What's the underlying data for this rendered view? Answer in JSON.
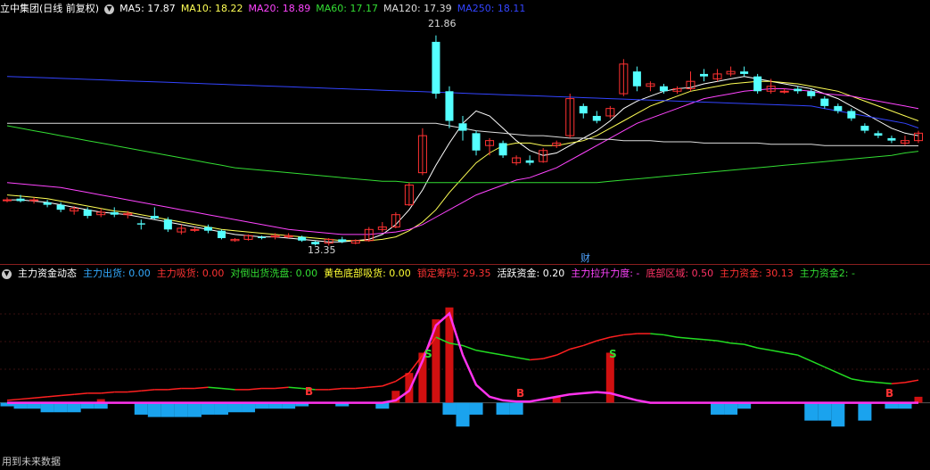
{
  "main_header": {
    "stock": "立中集团(日线 前复权)",
    "ma": [
      {
        "label": "MA5: 17.87",
        "color": "#ffffff"
      },
      {
        "label": "MA10: 18.22",
        "color": "#ffff55"
      },
      {
        "label": "MA20: 18.89",
        "color": "#ff44ff"
      },
      {
        "label": "MA60: 17.17",
        "color": "#33dd33"
      },
      {
        "label": "MA120: 17.39",
        "color": "#dddddd"
      },
      {
        "label": "MA250: 18.11",
        "color": "#3344ff"
      }
    ]
  },
  "price_labels": {
    "high": "21.86",
    "low": "13.35",
    "fin_marker": "财"
  },
  "indicator_header": {
    "name": "主力资金动态",
    "items": [
      {
        "label": "主力出货: 0.00",
        "color": "#33aaff"
      },
      {
        "label": "主力吸货: 0.00",
        "color": "#ff3333"
      },
      {
        "label": "对倒出货洗盘: 0.00",
        "color": "#33dd33"
      },
      {
        "label": "黄色底部吸货: 0.00",
        "color": "#ffff33"
      },
      {
        "label": "锁定筹码: 29.35",
        "color": "#ff3333"
      },
      {
        "label": "活跃资金: 0.20",
        "color": "#ffffff"
      },
      {
        "label": "主力拉升力度: -",
        "color": "#ff44ff"
      },
      {
        "label": "底部区域: 0.50",
        "color": "#ff3366"
      },
      {
        "label": "主力资金: 30.13",
        "color": "#ff3333"
      },
      {
        "label": "主力资金2: -",
        "color": "#33dd33"
      }
    ]
  },
  "markers": [
    "B",
    "S",
    "B",
    "S",
    "B"
  ],
  "footer": "用到未来数据",
  "chart_data": {
    "type": "candlestick",
    "ylim": [
      13.0,
      22.5
    ],
    "candles": [
      {
        "o": 15.2,
        "c": 15.2,
        "h": 15.3,
        "l": 15.1
      },
      {
        "o": 15.25,
        "c": 15.15,
        "h": 15.4,
        "l": 15.1
      },
      {
        "o": 15.2,
        "c": 15.2,
        "h": 15.3,
        "l": 15.05
      },
      {
        "o": 15.1,
        "c": 15.0,
        "h": 15.2,
        "l": 14.9
      },
      {
        "o": 15.0,
        "c": 14.8,
        "h": 15.1,
        "l": 14.7
      },
      {
        "o": 14.75,
        "c": 14.85,
        "h": 14.95,
        "l": 14.6
      },
      {
        "o": 14.8,
        "c": 14.55,
        "h": 14.9,
        "l": 14.45
      },
      {
        "o": 14.6,
        "c": 14.7,
        "h": 14.85,
        "l": 14.5
      },
      {
        "o": 14.7,
        "c": 14.6,
        "h": 14.9,
        "l": 14.5
      },
      {
        "o": 14.6,
        "c": 14.65,
        "h": 14.75,
        "l": 14.45
      },
      {
        "o": 14.25,
        "c": 14.2,
        "h": 14.4,
        "l": 14.0
      },
      {
        "o": 14.55,
        "c": 14.45,
        "h": 14.9,
        "l": 14.4
      },
      {
        "o": 14.4,
        "c": 14.0,
        "h": 14.5,
        "l": 13.9
      },
      {
        "o": 13.9,
        "c": 14.05,
        "h": 14.2,
        "l": 13.8
      },
      {
        "o": 14.0,
        "c": 14.0,
        "h": 14.1,
        "l": 13.9
      },
      {
        "o": 14.1,
        "c": 13.95,
        "h": 14.2,
        "l": 13.85
      },
      {
        "o": 13.95,
        "c": 13.65,
        "h": 14.0,
        "l": 13.6
      },
      {
        "o": 13.55,
        "c": 13.6,
        "h": 13.65,
        "l": 13.5
      },
      {
        "o": 13.6,
        "c": 13.75,
        "h": 13.8,
        "l": 13.55
      },
      {
        "o": 13.7,
        "c": 13.65,
        "h": 13.75,
        "l": 13.6
      },
      {
        "o": 13.7,
        "c": 13.75,
        "h": 13.85,
        "l": 13.6
      },
      {
        "o": 13.7,
        "c": 13.75,
        "h": 13.85,
        "l": 13.65
      },
      {
        "o": 13.7,
        "c": 13.55,
        "h": 13.75,
        "l": 13.5
      },
      {
        "o": 13.5,
        "c": 13.4,
        "h": 13.55,
        "l": 13.35
      },
      {
        "o": 13.45,
        "c": 13.6,
        "h": 13.65,
        "l": 13.35
      },
      {
        "o": 13.6,
        "c": 13.5,
        "h": 13.7,
        "l": 13.45
      },
      {
        "o": 13.45,
        "c": 13.55,
        "h": 13.6,
        "l": 13.4
      },
      {
        "o": 13.55,
        "c": 14.0,
        "h": 14.1,
        "l": 13.5
      },
      {
        "o": 14.0,
        "c": 14.1,
        "h": 14.3,
        "l": 13.9
      },
      {
        "o": 14.1,
        "c": 14.6,
        "h": 14.7,
        "l": 14.05
      },
      {
        "o": 15.0,
        "c": 15.8,
        "h": 15.9,
        "l": 14.95
      },
      {
        "o": 16.3,
        "c": 17.8,
        "h": 18.1,
        "l": 16.2
      },
      {
        "o": 21.6,
        "c": 19.5,
        "h": 21.86,
        "l": 19.3
      },
      {
        "o": 19.6,
        "c": 18.4,
        "h": 19.8,
        "l": 18.1
      },
      {
        "o": 18.3,
        "c": 18.0,
        "h": 18.6,
        "l": 17.6
      },
      {
        "o": 17.9,
        "c": 17.2,
        "h": 18.0,
        "l": 17.0
      },
      {
        "o": 17.4,
        "c": 17.6,
        "h": 17.7,
        "l": 17.0
      },
      {
        "o": 17.5,
        "c": 17.0,
        "h": 17.6,
        "l": 16.9
      },
      {
        "o": 16.7,
        "c": 16.9,
        "h": 17.0,
        "l": 16.6
      },
      {
        "o": 16.8,
        "c": 16.7,
        "h": 17.0,
        "l": 16.6
      },
      {
        "o": 16.75,
        "c": 17.2,
        "h": 17.3,
        "l": 16.7
      },
      {
        "o": 17.4,
        "c": 17.5,
        "h": 17.6,
        "l": 17.3
      },
      {
        "o": 17.8,
        "c": 19.3,
        "h": 19.5,
        "l": 17.7
      },
      {
        "o": 19.0,
        "c": 18.7,
        "h": 19.1,
        "l": 18.5
      },
      {
        "o": 18.6,
        "c": 18.4,
        "h": 18.8,
        "l": 18.3
      },
      {
        "o": 18.6,
        "c": 18.9,
        "h": 19.0,
        "l": 18.5
      },
      {
        "o": 19.5,
        "c": 20.7,
        "h": 20.9,
        "l": 19.4
      },
      {
        "o": 20.4,
        "c": 19.8,
        "h": 20.6,
        "l": 19.6
      },
      {
        "o": 19.8,
        "c": 19.9,
        "h": 20.0,
        "l": 19.6
      },
      {
        "o": 19.8,
        "c": 19.6,
        "h": 19.9,
        "l": 19.5
      },
      {
        "o": 19.6,
        "c": 19.7,
        "h": 19.8,
        "l": 19.5
      },
      {
        "o": 19.7,
        "c": 20.0,
        "h": 20.4,
        "l": 19.6
      },
      {
        "o": 20.3,
        "c": 20.2,
        "h": 20.5,
        "l": 20.0
      },
      {
        "o": 20.1,
        "c": 20.3,
        "h": 20.5,
        "l": 20.0
      },
      {
        "o": 20.3,
        "c": 20.4,
        "h": 20.6,
        "l": 20.2
      },
      {
        "o": 20.4,
        "c": 20.3,
        "h": 20.6,
        "l": 20.2
      },
      {
        "o": 20.2,
        "c": 19.6,
        "h": 20.3,
        "l": 19.5
      },
      {
        "o": 19.6,
        "c": 19.8,
        "h": 20.1,
        "l": 19.5
      },
      {
        "o": 19.6,
        "c": 19.6,
        "h": 19.7,
        "l": 19.5
      },
      {
        "o": 19.7,
        "c": 19.6,
        "h": 19.8,
        "l": 19.5
      },
      {
        "o": 19.6,
        "c": 19.4,
        "h": 19.7,
        "l": 19.3
      },
      {
        "o": 19.3,
        "c": 19.0,
        "h": 19.4,
        "l": 18.9
      },
      {
        "o": 19.0,
        "c": 18.8,
        "h": 19.1,
        "l": 18.7
      },
      {
        "o": 18.8,
        "c": 18.5,
        "h": 18.9,
        "l": 18.4
      },
      {
        "o": 18.2,
        "c": 18.0,
        "h": 18.3,
        "l": 17.9
      },
      {
        "o": 17.9,
        "c": 17.8,
        "h": 18.0,
        "l": 17.7
      },
      {
        "o": 17.7,
        "c": 17.6,
        "h": 17.8,
        "l": 17.5
      },
      {
        "o": 17.5,
        "c": 17.6,
        "h": 17.8,
        "l": 17.4
      },
      {
        "o": 17.6,
        "c": 17.9,
        "h": 18.0,
        "l": 17.5
      }
    ],
    "ma_lines": [
      {
        "name": "MA5",
        "color": "#ffffff",
        "values": [
          15.2,
          15.2,
          15.15,
          15.1,
          15.0,
          14.9,
          14.8,
          14.7,
          14.65,
          14.6,
          14.5,
          14.4,
          14.3,
          14.2,
          14.1,
          14.0,
          13.9,
          13.8,
          13.75,
          13.7,
          13.7,
          13.65,
          13.6,
          13.55,
          13.5,
          13.5,
          13.55,
          13.6,
          13.8,
          14.2,
          14.8,
          15.6,
          16.6,
          17.5,
          18.3,
          18.8,
          18.6,
          18.1,
          17.6,
          17.2,
          17.0,
          17.1,
          17.4,
          17.7,
          18.0,
          18.4,
          18.9,
          19.2,
          19.4,
          19.6,
          19.7,
          19.75,
          19.9,
          20.0,
          20.1,
          20.2,
          20.1,
          20.0,
          19.9,
          19.8,
          19.7,
          19.5,
          19.3,
          19.0,
          18.7,
          18.4,
          18.1,
          17.9,
          17.8
        ]
      },
      {
        "name": "MA10",
        "color": "#ffff55",
        "values": [
          15.4,
          15.35,
          15.3,
          15.25,
          15.15,
          15.05,
          14.95,
          14.85,
          14.75,
          14.7,
          14.6,
          14.5,
          14.4,
          14.3,
          14.2,
          14.1,
          14.0,
          13.95,
          13.9,
          13.85,
          13.8,
          13.75,
          13.7,
          13.65,
          13.6,
          13.55,
          13.55,
          13.55,
          13.6,
          13.7,
          13.95,
          14.3,
          14.8,
          15.5,
          16.1,
          16.7,
          17.1,
          17.4,
          17.5,
          17.5,
          17.4,
          17.4,
          17.5,
          17.6,
          17.8,
          18.1,
          18.4,
          18.7,
          19.0,
          19.2,
          19.4,
          19.6,
          19.7,
          19.8,
          19.9,
          19.95,
          20.0,
          20.0,
          19.95,
          19.9,
          19.8,
          19.7,
          19.6,
          19.4,
          19.2,
          19.0,
          18.8,
          18.6,
          18.4
        ]
      },
      {
        "name": "MA20",
        "color": "#ff44ff",
        "values": [
          15.9,
          15.85,
          15.8,
          15.75,
          15.7,
          15.6,
          15.5,
          15.4,
          15.3,
          15.2,
          15.1,
          15.0,
          14.9,
          14.8,
          14.7,
          14.6,
          14.5,
          14.4,
          14.3,
          14.2,
          14.1,
          14.0,
          13.95,
          13.9,
          13.85,
          13.8,
          13.8,
          13.8,
          13.85,
          13.9,
          14.0,
          14.2,
          14.5,
          14.8,
          15.1,
          15.4,
          15.6,
          15.8,
          16.0,
          16.1,
          16.3,
          16.5,
          16.8,
          17.1,
          17.4,
          17.7,
          18.0,
          18.3,
          18.5,
          18.7,
          18.9,
          19.1,
          19.3,
          19.4,
          19.5,
          19.6,
          19.65,
          19.7,
          19.7,
          19.65,
          19.6,
          19.5,
          19.45,
          19.4,
          19.3,
          19.2,
          19.1,
          19.0,
          18.9
        ]
      },
      {
        "name": "MA60",
        "color": "#33dd33",
        "values": [
          18.2,
          18.1,
          18.0,
          17.9,
          17.8,
          17.7,
          17.6,
          17.5,
          17.4,
          17.3,
          17.2,
          17.1,
          17.0,
          16.9,
          16.8,
          16.7,
          16.6,
          16.5,
          16.45,
          16.4,
          16.35,
          16.3,
          16.25,
          16.2,
          16.15,
          16.1,
          16.05,
          16.0,
          15.95,
          15.95,
          15.9,
          15.9,
          15.9,
          15.9,
          15.9,
          15.9,
          15.9,
          15.9,
          15.9,
          15.9,
          15.9,
          15.9,
          15.9,
          15.9,
          15.9,
          15.95,
          16.0,
          16.05,
          16.1,
          16.15,
          16.2,
          16.25,
          16.3,
          16.35,
          16.4,
          16.45,
          16.5,
          16.55,
          16.6,
          16.65,
          16.7,
          16.75,
          16.8,
          16.85,
          16.9,
          16.95,
          17.0,
          17.1,
          17.17
        ]
      },
      {
        "name": "MA120",
        "color": "#dddddd",
        "values": [
          18.3,
          18.3,
          18.3,
          18.3,
          18.3,
          18.3,
          18.3,
          18.3,
          18.3,
          18.3,
          18.3,
          18.3,
          18.3,
          18.3,
          18.3,
          18.3,
          18.3,
          18.3,
          18.3,
          18.3,
          18.3,
          18.3,
          18.3,
          18.3,
          18.3,
          18.3,
          18.3,
          18.3,
          18.3,
          18.3,
          18.3,
          18.3,
          18.3,
          18.2,
          18.1,
          18.0,
          17.95,
          17.9,
          17.85,
          17.8,
          17.8,
          17.75,
          17.7,
          17.7,
          17.65,
          17.65,
          17.6,
          17.6,
          17.6,
          17.55,
          17.55,
          17.55,
          17.5,
          17.5,
          17.5,
          17.5,
          17.5,
          17.45,
          17.45,
          17.45,
          17.45,
          17.4,
          17.4,
          17.4,
          17.4,
          17.4,
          17.39,
          17.39,
          17.39
        ]
      },
      {
        "name": "MA250",
        "color": "#3344ff",
        "values": [
          20.2,
          20.18,
          20.16,
          20.14,
          20.12,
          20.1,
          20.08,
          20.06,
          20.04,
          20.02,
          20.0,
          19.98,
          19.96,
          19.94,
          19.92,
          19.9,
          19.88,
          19.86,
          19.84,
          19.82,
          19.8,
          19.78,
          19.76,
          19.74,
          19.72,
          19.7,
          19.68,
          19.66,
          19.64,
          19.62,
          19.6,
          19.58,
          19.56,
          19.54,
          19.52,
          19.5,
          19.48,
          19.46,
          19.44,
          19.42,
          19.4,
          19.38,
          19.36,
          19.34,
          19.32,
          19.3,
          19.28,
          19.26,
          19.24,
          19.22,
          19.2,
          19.18,
          19.16,
          19.14,
          19.12,
          19.1,
          19.08,
          19.06,
          19.04,
          19.02,
          19.0,
          18.9,
          18.8,
          18.7,
          18.6,
          18.5,
          18.4,
          18.3,
          18.11
        ]
      }
    ],
    "indicator": {
      "ylim": [
        -40,
        100
      ],
      "red_bars": [
        0,
        0,
        0,
        0,
        0,
        0,
        0,
        3,
        0,
        0,
        0,
        0,
        0,
        0,
        0,
        0,
        0,
        0,
        0,
        0,
        0,
        0,
        0,
        0,
        0,
        0,
        0,
        0,
        0,
        10,
        25,
        42,
        70,
        80,
        0,
        0,
        0,
        0,
        0,
        0,
        0,
        5,
        0,
        0,
        0,
        42,
        0,
        0,
        0,
        0,
        0,
        0,
        0,
        0,
        0,
        0,
        0,
        0,
        0,
        0,
        0,
        0,
        0,
        0,
        0,
        0,
        0,
        0,
        5
      ],
      "blue_bars": [
        -3,
        -5,
        -5,
        -8,
        -8,
        -8,
        -5,
        -5,
        0,
        0,
        -10,
        -12,
        -12,
        -12,
        -12,
        -10,
        -10,
        -8,
        -8,
        -5,
        -5,
        -5,
        -3,
        0,
        0,
        -3,
        0,
        0,
        -5,
        0,
        0,
        0,
        0,
        -10,
        -20,
        -10,
        0,
        -10,
        -10,
        0,
        0,
        0,
        0,
        0,
        0,
        0,
        0,
        0,
        0,
        0,
        0,
        0,
        0,
        -10,
        -10,
        -5,
        0,
        0,
        0,
        0,
        -15,
        -15,
        -20,
        0,
        -15,
        0,
        -5,
        -5,
        0
      ],
      "lock_line": [
        2,
        3,
        4,
        5,
        6,
        7,
        8,
        8,
        9,
        9,
        10,
        11,
        11,
        12,
        12,
        13,
        12,
        11,
        11,
        12,
        12,
        13,
        12,
        11,
        11,
        12,
        12,
        13,
        14,
        18,
        25,
        40,
        55,
        50,
        48,
        44,
        42,
        40,
        38,
        36,
        37,
        40,
        45,
        48,
        52,
        55,
        57,
        58,
        58,
        57,
        55,
        54,
        53,
        52,
        50,
        49,
        46,
        44,
        42,
        40,
        35,
        30,
        25,
        20,
        18,
        17,
        16,
        17,
        19
      ],
      "pull_line": [
        0,
        0,
        0,
        0,
        0,
        0,
        0,
        0,
        0,
        0,
        0,
        0,
        0,
        0,
        0,
        0,
        0,
        0,
        0,
        0,
        0,
        0,
        0,
        0,
        0,
        0,
        0,
        0,
        0,
        2,
        10,
        35,
        65,
        75,
        40,
        15,
        5,
        2,
        1,
        1,
        3,
        5,
        7,
        8,
        9,
        8,
        5,
        2,
        0,
        0,
        0,
        0,
        0,
        0,
        0,
        0,
        0,
        0,
        0,
        0,
        0,
        0,
        0,
        0,
        0,
        0,
        0,
        0,
        0
      ]
    }
  }
}
